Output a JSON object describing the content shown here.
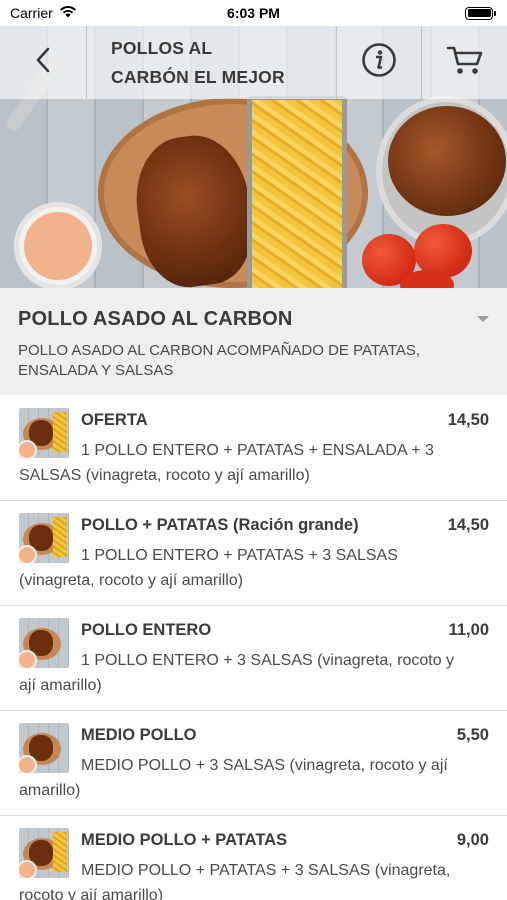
{
  "status_bar": {
    "carrier": "Carrier",
    "time": "6:03 PM"
  },
  "header": {
    "title_line1": "POLLOS AL",
    "title_line2": "CARBÓN EL MEJOR",
    "back_icon": "chevron-left-icon",
    "info_icon": "info-icon",
    "cart_icon": "cart-icon"
  },
  "category": {
    "title": "POLLO ASADO AL CARBON",
    "description": "POLLO ASADO AL CARBON ACOMPAÑADO DE PATATAS, ENSALADA Y SALSAS",
    "toggle_icon": "triangle-down-icon"
  },
  "items": [
    {
      "name": "OFERTA",
      "price": "14,50",
      "description": "1 POLLO ENTERO + PATATAS + ENSALADA + 3 SALSAS (vinagreta, rocoto y ají amarillo)"
    },
    {
      "name": "POLLO + PATATAS (Ración grande)",
      "price": "14,50",
      "description": "1 POLLO ENTERO + PATATAS + 3 SALSAS (vinagreta, rocoto y ají amarillo)"
    },
    {
      "name": "POLLO ENTERO",
      "price": "11,00",
      "description": "1 POLLO ENTERO + 3 SALSAS (vinagreta, rocoto y ají amarillo)"
    },
    {
      "name": "MEDIO POLLO",
      "price": "5,50",
      "description": "MEDIO POLLO + 3 SALSAS (vinagreta, rocoto y ají amarillo)"
    },
    {
      "name": "MEDIO POLLO + PATATAS",
      "price": "9,00",
      "description": "MEDIO POLLO + PATATAS + 3 SALSAS (vinagreta, rocoto y ají amarillo)"
    }
  ],
  "colors": {
    "category_bg": "#efefef",
    "text_dark": "#3b3b3b",
    "divider": "#dedede"
  }
}
